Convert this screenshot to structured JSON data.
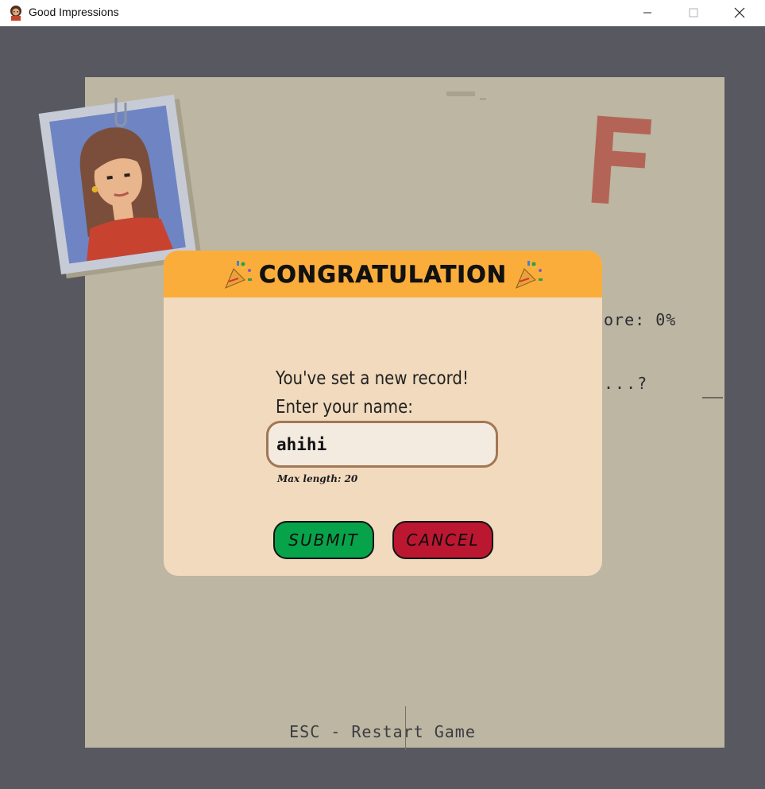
{
  "window": {
    "title": "Good Impressions",
    "icon": "girl-avatar-icon",
    "controls": [
      "minimize-icon",
      "maximize-icon",
      "close-icon"
    ]
  },
  "game": {
    "grade_letter": "F",
    "score_partial": "ore: 0%",
    "question_partial": "...?",
    "footer_hint": "ESC - Restart Game"
  },
  "dialog": {
    "title": "CONGRATULATION",
    "title_icon": "party-popper-icon",
    "message_line1": "You've set a new record!",
    "message_line2": "Enter your name:",
    "name_value": "ahihi",
    "max_length_hint": "Max length: 20",
    "submit_label": "SUBMIT",
    "cancel_label": "CANCEL"
  },
  "colors": {
    "header": "#fbad3c",
    "dialog_bg": "#f1dabd",
    "submit": "#07a34a",
    "cancel": "#bb1731",
    "grade": "#b46456"
  }
}
